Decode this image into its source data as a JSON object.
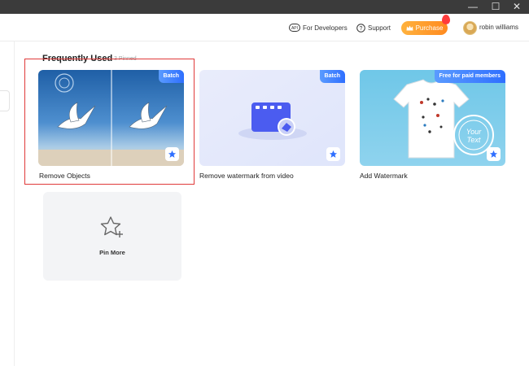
{
  "window": {
    "minimize": "—",
    "maximize": "☐",
    "close": "✕"
  },
  "header": {
    "developers_label": "For Developers",
    "support_label": "Support",
    "purchase_label": "Purchase",
    "username": "robin williams"
  },
  "section": {
    "title": "Frequently Used",
    "subtitle": "3 Pinned"
  },
  "cards": [
    {
      "label": "Remove Objects",
      "badge": "Batch"
    },
    {
      "label": "Remove watermark from video",
      "badge": "Batch"
    },
    {
      "label": "Add Watermark",
      "badge": "Free for paid members"
    }
  ],
  "pin_more": {
    "label": "Pin More"
  },
  "colors": {
    "accent": "#2f6fff",
    "purchase": "#ff8a1f",
    "selection": "#e03a3a"
  }
}
